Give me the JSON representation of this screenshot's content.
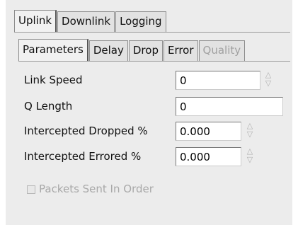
{
  "tabs": {
    "outer": [
      "Uplink",
      "Downlink",
      "Logging"
    ],
    "outer_active": "Uplink",
    "inner": [
      "Parameters",
      "Delay",
      "Drop",
      "Error",
      "Quality"
    ],
    "inner_active": "Parameters",
    "inner_disabled": "Quality"
  },
  "fields": {
    "link_speed": {
      "label": "Link Speed",
      "value": "0"
    },
    "q_length": {
      "label": "Q Length",
      "value": "0"
    },
    "intercepted_dropped": {
      "label": "Intercepted Dropped %",
      "value": "0.000"
    },
    "intercepted_errored": {
      "label": "Intercepted Errored %",
      "value": "0.000"
    }
  },
  "packets_sent_in_order": {
    "label": "Packets Sent In Order",
    "checked": false,
    "enabled": false
  },
  "icons": {
    "spinner": "spin-arrows-icon"
  },
  "colors": {
    "panel_bg": "#ececec",
    "disabled_text": "#a8a8a8"
  }
}
